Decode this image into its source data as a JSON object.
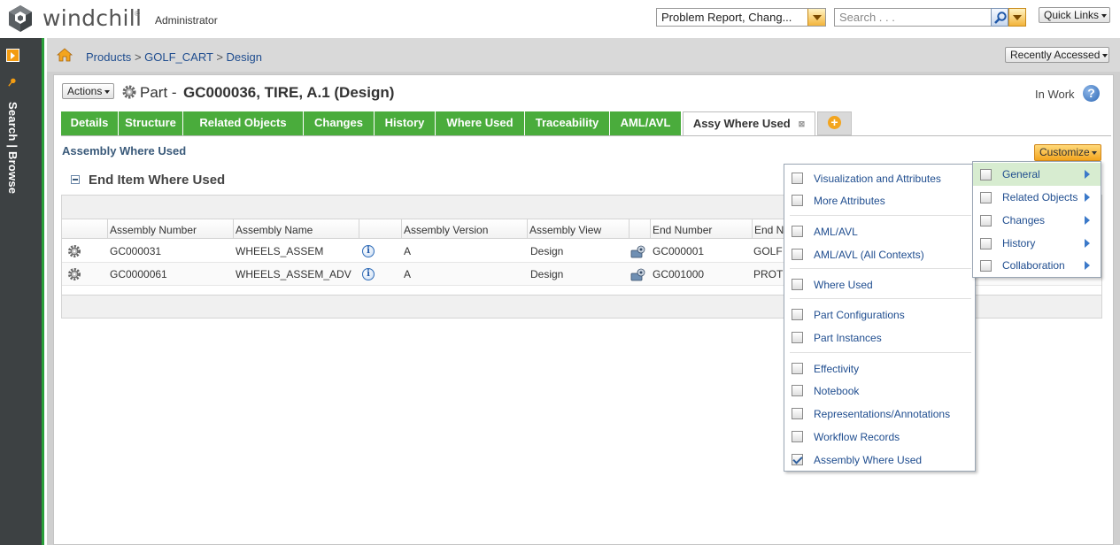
{
  "header": {
    "logo_text": "windchill",
    "logo_tm": "®",
    "role": "Administrator",
    "context_select": "Problem Report, Chang...",
    "search_placeholder": "Search . . .",
    "quick_links": "Quick Links"
  },
  "leftnav": {
    "vertical_label": "Search | Browse"
  },
  "breadcrumb": {
    "items": [
      "Products",
      "GOLF_CART",
      "Design"
    ],
    "separator": ">",
    "recently_accessed": "Recently Accessed"
  },
  "object": {
    "actions_label": "Actions",
    "type_prefix": "Part -",
    "title": "GC000036, TIRE, A.1 (Design)",
    "state": "In Work",
    "help": "?"
  },
  "tabs": [
    {
      "label": "Details"
    },
    {
      "label": "Structure"
    },
    {
      "label": "Related Objects"
    },
    {
      "label": "Changes"
    },
    {
      "label": "History"
    },
    {
      "label": "Where Used"
    },
    {
      "label": "Traceability"
    },
    {
      "label": "AML/AVL"
    },
    {
      "label": "Assy Where Used",
      "active": true
    }
  ],
  "section": {
    "title": "Assembly Where Used",
    "customize_label": "Customize"
  },
  "table": {
    "title": "End Item Where Used",
    "columns": [
      "Assembly Number",
      "Assembly Name",
      "",
      "Assembly Version",
      "Assembly View",
      "",
      "End Number",
      "End Na"
    ],
    "rows": [
      {
        "assembly_number": "GC000031",
        "assembly_name": "WHEELS_ASSEM",
        "version": "A",
        "view": "Design",
        "end_number": "GC000001",
        "end_name": "GOLF"
      },
      {
        "assembly_number": "GC0000061",
        "assembly_name": "WHEELS_ASSEM_ADV",
        "version": "A",
        "view": "Design",
        "end_number": "GC001000",
        "end_name": "PROT"
      }
    ]
  },
  "customize_menu": {
    "items": [
      {
        "label": "Visualization and Attributes",
        "checked": false
      },
      {
        "label": "More Attributes",
        "checked": false
      },
      {
        "label": "AML/AVL",
        "checked": false
      },
      {
        "label": "AML/AVL (All Contexts)",
        "checked": false
      },
      {
        "label": "Where Used",
        "checked": false
      },
      {
        "label": "Part Configurations",
        "checked": false
      },
      {
        "label": "Part Instances",
        "checked": false
      },
      {
        "label": "Effectivity",
        "checked": false
      },
      {
        "label": "Notebook",
        "checked": false
      },
      {
        "label": "Representations/Annotations",
        "checked": false
      },
      {
        "label": "Workflow Records",
        "checked": false
      },
      {
        "label": "Assembly Where Used",
        "checked": true
      }
    ],
    "submenu": [
      {
        "label": "General",
        "highlight": true
      },
      {
        "label": "Related Objects"
      },
      {
        "label": "Changes"
      },
      {
        "label": "History"
      },
      {
        "label": "Collaboration"
      }
    ]
  },
  "colors": {
    "tab_green": "#4aac3c",
    "link_blue": "#1f4d8f",
    "accent_orange": "#f3a51f",
    "nav_dark": "#3d4143"
  }
}
